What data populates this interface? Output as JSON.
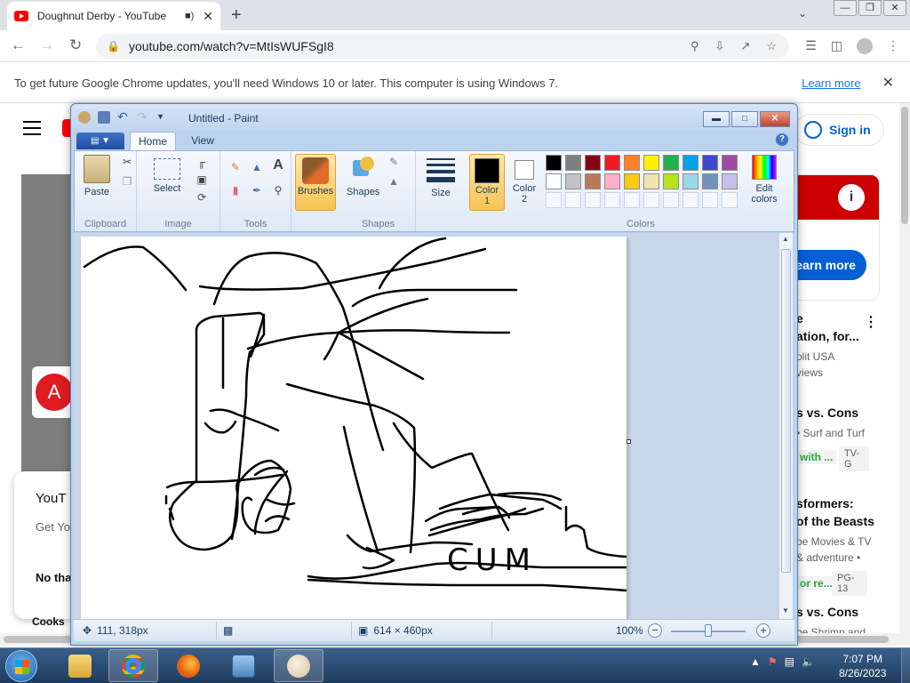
{
  "browser": {
    "tab_title": "Doughnut Derby - YouTube",
    "url": "youtube.com/watch?v=MtIsWUFSgI8",
    "infobar_message": "To get future Google Chrome updates, you'll need Windows 10 or later. This computer is using Windows 7.",
    "infobar_link": "Learn more"
  },
  "youtube": {
    "sign_in": "Sign in",
    "ad_button": "earn more",
    "popup_title": "YouT",
    "popup_body": "Get Yo",
    "popup_action": "No tha",
    "cooks": "Cooks",
    "recs": [
      {
        "line1": "e",
        "line2": "ation, for...",
        "line3": "olit USA",
        "line4": "views"
      },
      {
        "line1": "s vs. Cons",
        "line2": "• Surf and Turf",
        "tag": "with ...",
        "badge": "TV-G"
      },
      {
        "line1": "sformers:",
        "line2": "of the Beasts",
        "line3": "be Movies & TV",
        "line4": "& adventure •",
        "tag": "or re...",
        "badge": "PG-13"
      },
      {
        "line1": "s vs. Cons",
        "line2": "be Shrimp and"
      }
    ]
  },
  "paint": {
    "window_title": "Untitled - Paint",
    "tabs": [
      "Home",
      "View"
    ],
    "groups": {
      "clipboard": {
        "label": "Clipboard",
        "paste": "Paste"
      },
      "image": {
        "label": "Image",
        "select": "Select"
      },
      "tools": {
        "label": "Tools"
      },
      "brushes": {
        "label": "Brushes"
      },
      "shapes": {
        "label": "Shapes",
        "button": "Shapes"
      },
      "size": {
        "label": "Size"
      },
      "colors": {
        "label": "Colors",
        "color1": "Color\n1",
        "color2": "Color\n2",
        "edit": "Edit colors",
        "palette_row1": [
          "#000000",
          "#7f7f7f",
          "#880015",
          "#ed1c24",
          "#ff7f27",
          "#fff200",
          "#22b14c",
          "#00a2e8",
          "#3f48cc",
          "#a349a4"
        ],
        "palette_row2": [
          "#ffffff",
          "#c3c3c3",
          "#b97a57",
          "#ffaec9",
          "#ffc90e",
          "#efe4b0",
          "#b5e61d",
          "#99d9ea",
          "#7092be",
          "#c8bfe7"
        ]
      }
    },
    "canvas_text": "CUM",
    "status": {
      "cursor_pos": "111, 318px",
      "canvas_size": "614 × 460px",
      "zoom": "100%"
    }
  },
  "taskbar": {
    "time": "7:07 PM",
    "date": "8/26/2023"
  }
}
